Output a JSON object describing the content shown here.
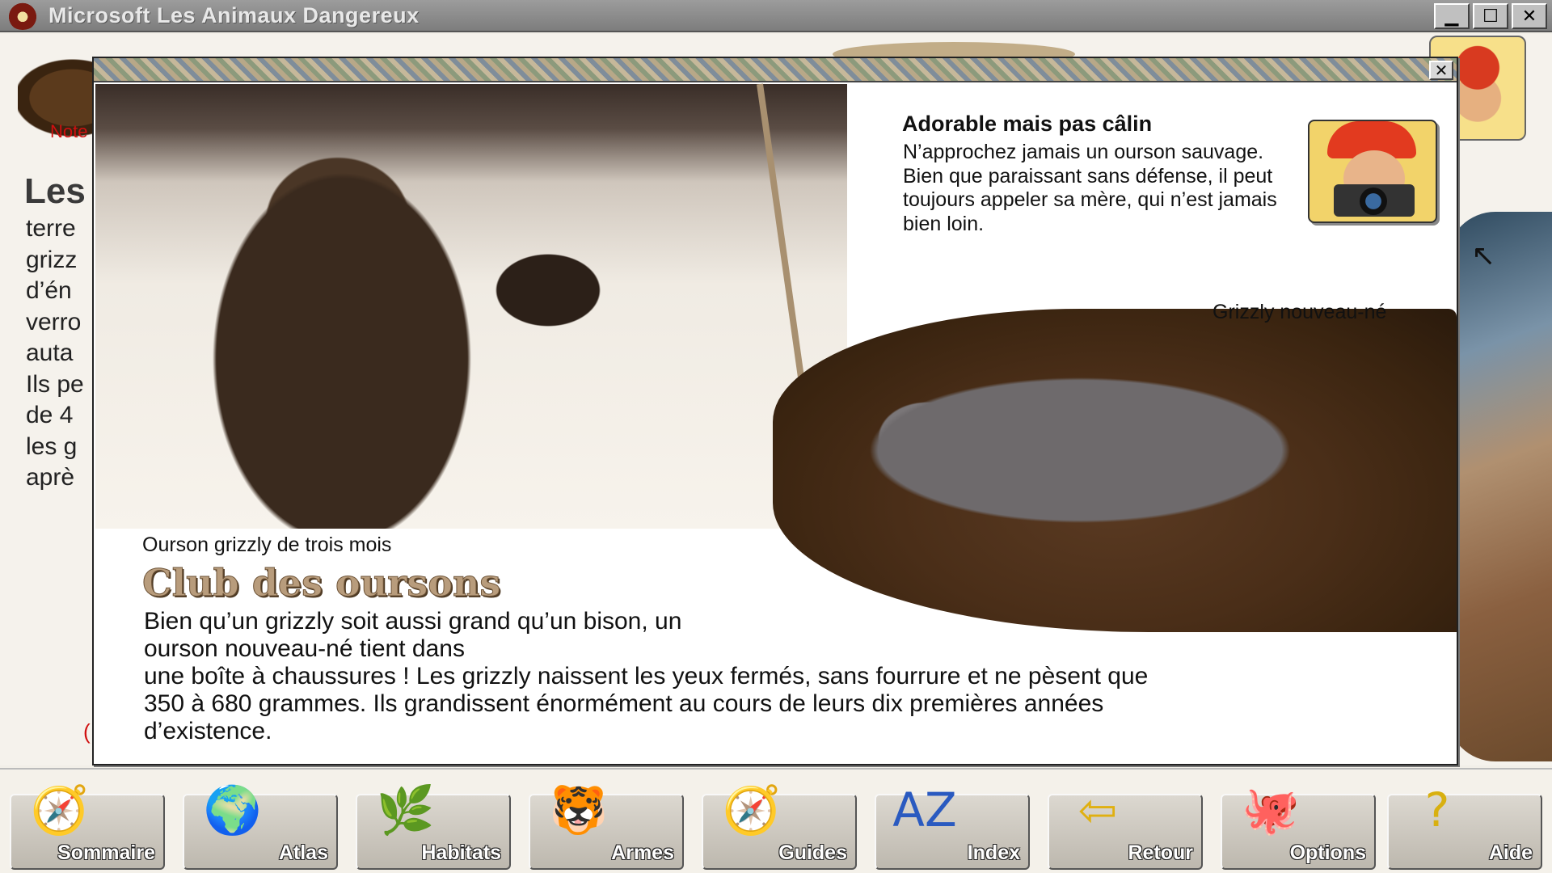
{
  "window": {
    "title": "Microsoft Les Animaux Dangereux",
    "minimize": "▁",
    "maximize": "☐",
    "close": "✕"
  },
  "background_page": {
    "note_label": "Note",
    "heading_fragment": "Les",
    "line_fragments": [
      "terre",
      "grizz",
      "d’én",
      "verro",
      "auta",
      "Ils pe",
      "de 4",
      "les g",
      "aprè"
    ],
    "red_fragment": "("
  },
  "popup": {
    "close": "✕",
    "cub_caption": "Ourson grizzly de trois mois",
    "newborn_caption": "Grizzly nouveau-né",
    "side_title": "Adorable mais pas câlin",
    "side_text": "N’approchez jamais un ourson sauvage. Bien que paraissant sans défense, il peut toujours appeler sa mère, qui n’est jamais bien loin.",
    "club_title": "Club des oursons",
    "club_text_line1": "Bien qu’un grizzly soit aussi grand qu’un bison, un ourson nouveau-né tient dans",
    "club_text_rest": "une boîte à chaussures ! Les grizzly naissent les yeux fermés, sans fourrure et ne pèsent que 350 à 680 grammes. Ils grandissent énormément au cours de leurs dix premières années d’existence."
  },
  "toolbar": {
    "buttons": [
      {
        "label": "Sommaire",
        "icon": "compass-map-icon",
        "glyph": "🧭",
        "color": "#8a6a3a"
      },
      {
        "label": "Atlas",
        "icon": "globe-icon",
        "glyph": "🌍",
        "color": "#2a6ab0"
      },
      {
        "label": "Habitats",
        "icon": "plant-icon",
        "glyph": "🌿",
        "color": "#3a8a2a"
      },
      {
        "label": "Armes",
        "icon": "tiger-icon",
        "glyph": "🐯",
        "color": "#c07a20"
      },
      {
        "label": "Guides",
        "icon": "compass-icon",
        "glyph": "🧭",
        "color": "#555"
      },
      {
        "label": "Index",
        "icon": "az-spider-icon",
        "glyph": "AZ",
        "color": "#2a5ac0"
      },
      {
        "label": "Retour",
        "icon": "scorpion-arrow-icon",
        "glyph": "⇦",
        "color": "#e0b010"
      },
      {
        "label": "Options",
        "icon": "octopus-icon",
        "glyph": "🐙",
        "color": "#d06020"
      },
      {
        "label": "Aide",
        "icon": "question-snake-icon",
        "glyph": "?",
        "color": "#d8b010"
      }
    ]
  }
}
